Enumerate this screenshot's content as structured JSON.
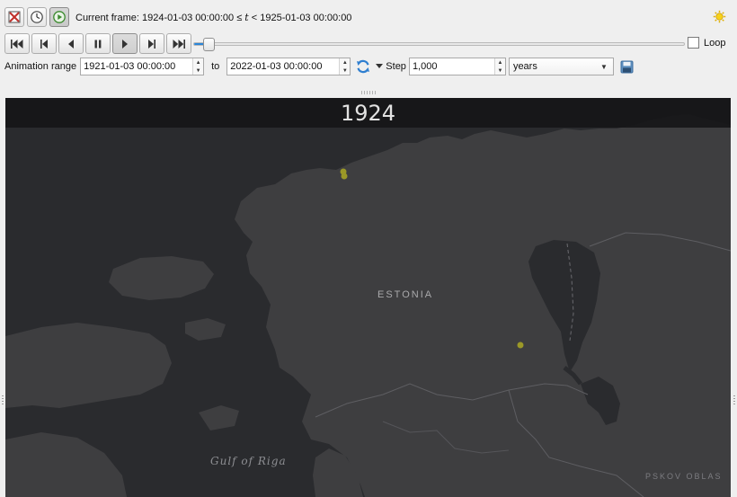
{
  "toolbar": {
    "current_frame_prefix": "Current frame: ",
    "frame_start": "1924-01-03 00:00:00",
    "frame_leq": "≤",
    "frame_var": "t",
    "frame_lt": "<",
    "frame_end": "1925-01-03 00:00:00",
    "loop_label": "Loop",
    "loop_checked": false,
    "slider_value_fraction": 0.03
  },
  "range": {
    "label": "Animation range",
    "start": "1921-01-03 00:00:00",
    "to_label": "to",
    "end": "2022-01-03 00:00:00",
    "step_label": "Step",
    "step_value": "1,000",
    "step_unit": "years"
  },
  "map": {
    "year": "1924",
    "country_label": "ESTONIA",
    "gulf_label": "Gulf of Riga",
    "region_label": "PSKOV OBLAS",
    "water_color": "#2a2b2e",
    "land_color": "#3e3e40",
    "point_color": "#9b9827"
  },
  "icons": {
    "fixed_range": "fixed-range-icon",
    "temporal_clock": "clock-icon",
    "play_mode": "play-circle-icon",
    "settings": "sun-settings-icon",
    "refresh": "refresh-icon",
    "save": "save-icon"
  }
}
